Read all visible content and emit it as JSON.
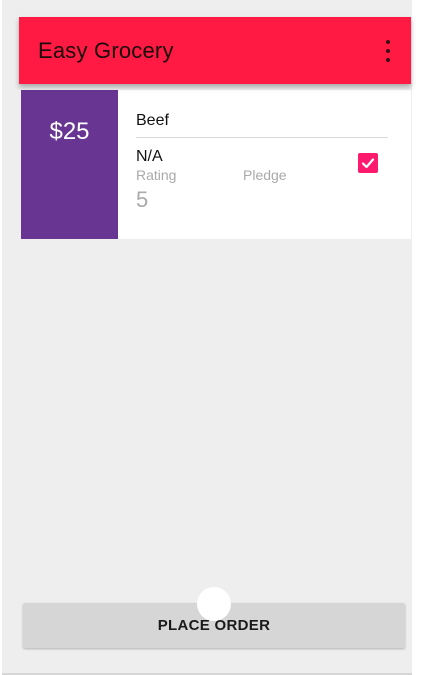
{
  "app": {
    "title": "Easy Grocery",
    "menu_icon": "more-vert-icon"
  },
  "item": {
    "price": "$25",
    "name": "Beef",
    "status": "N/A",
    "rating_label": "Rating",
    "pledge_label": "Pledge",
    "rating_value": "5",
    "pledged": true
  },
  "actions": {
    "place_order_label": "PLACE ORDER"
  },
  "colors": {
    "appbar": "#ff1a44",
    "price_box": "#693593",
    "checkbox": "#ff1a6e",
    "background": "#eeeeee"
  }
}
